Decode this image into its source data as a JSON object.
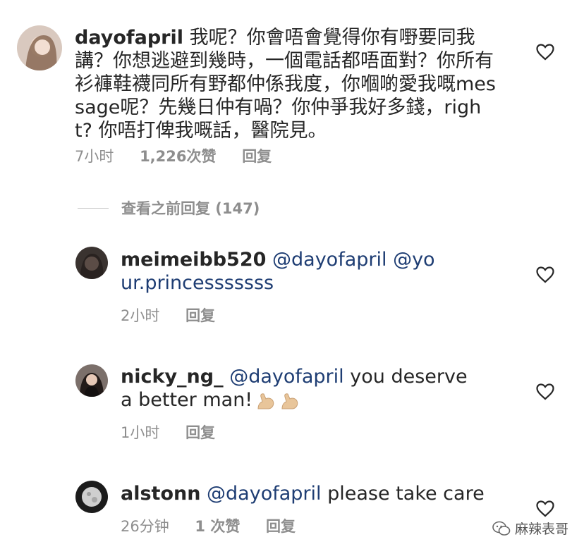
{
  "comments": [
    {
      "username": "dayofapril",
      "mention": "",
      "text": "我呢？你會唔會覺得你有嘢要同我講？你想逃避到幾時，一個電話都唔面對？你所有衫褲鞋襪同所有野都仲係我度，你嗰啲愛我嘅message呢？先幾日仲有喎？你仲爭我好多錢，right? 你唔打俾我嘅話，醫院見。",
      "time": "7小时",
      "likes": "1,226次赞",
      "reply": "回复"
    },
    {
      "username": "meimeibb520",
      "mention": "@dayofapril @your.princesssssss",
      "text": "",
      "time": "2小时",
      "likes": "",
      "reply": "回复"
    },
    {
      "username": "nicky_ng_",
      "mention": "@dayofapril",
      "text": "you deserve a better man!",
      "time": "1小时",
      "likes": "",
      "reply": "回复"
    },
    {
      "username": "alstonn",
      "mention": "@dayofapril",
      "text": "please take care",
      "time": "26分钟",
      "likes": "1 次赞",
      "reply": "回复"
    }
  ],
  "view_previous": "查看之前回复 (147)",
  "watermark": "麻辣表哥",
  "icons": {
    "heart": "heart-outline-icon",
    "emoji": "flexed-biceps-emoji",
    "watermark": "wechat-icon"
  },
  "colors": {
    "text": "#262626",
    "meta": "#8e8e8e",
    "mention": "#1e3d73"
  }
}
